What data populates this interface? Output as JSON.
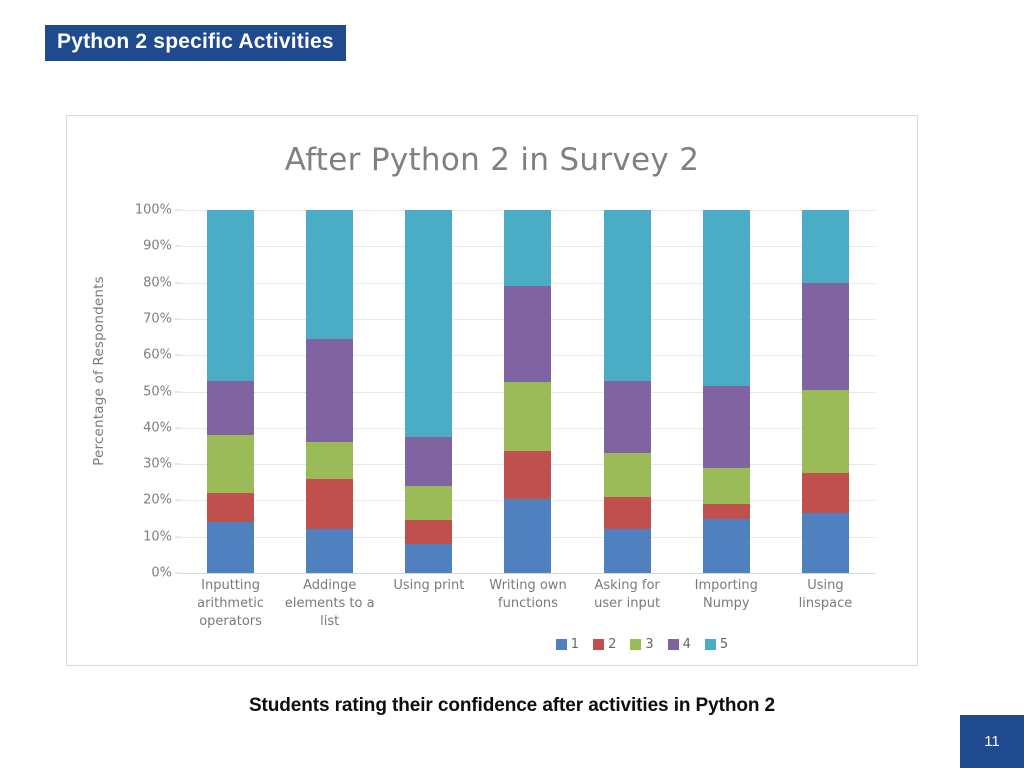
{
  "slide": {
    "title": "Python 2  specific Activities",
    "caption": "Students rating their confidence after activities in Python 2",
    "page_number": "11",
    "accent_color": "#1f4b8e"
  },
  "chart_data": {
    "type": "bar",
    "stacked": true,
    "title": "After Python 2 in Survey 2",
    "xlabel": "",
    "ylabel": "Percentage of Respondents",
    "ylim": [
      0,
      100
    ],
    "ytick_labels": [
      "100%",
      "90%",
      "80%",
      "70%",
      "60%",
      "50%",
      "40%",
      "30%",
      "20%",
      "10%",
      "0%"
    ],
    "ytick_values": [
      100,
      90,
      80,
      70,
      60,
      50,
      40,
      30,
      20,
      10,
      0
    ],
    "grid": true,
    "legend_position": "bottom-right",
    "categories": [
      "Inputting arithmetic operators",
      "Addinge elements to a list",
      "Using print",
      "Writing own functions",
      "Asking for user input",
      "Importing Numpy",
      "Using linspace"
    ],
    "category_lines": [
      [
        "Inputting",
        "arithmetic",
        "operators"
      ],
      [
        "Addinge",
        "elements to a",
        "list"
      ],
      [
        "Using print"
      ],
      [
        "Writing own",
        "functions"
      ],
      [
        "Asking for",
        "user input"
      ],
      [
        "Importing",
        "Numpy"
      ],
      [
        "Using",
        "linspace"
      ]
    ],
    "series": [
      {
        "name": "1",
        "color": "#4e81bd",
        "values": [
          14,
          12,
          8,
          20.5,
          12,
          15,
          16.5
        ]
      },
      {
        "name": "2",
        "color": "#c0504d",
        "values": [
          8,
          14,
          6.5,
          13,
          9,
          4,
          11
        ]
      },
      {
        "name": "3",
        "color": "#9bbb59",
        "values": [
          16,
          10,
          9.5,
          19,
          12,
          10,
          23
        ]
      },
      {
        "name": "4",
        "color": "#8064a2",
        "values": [
          15,
          28.5,
          13.5,
          26.5,
          20,
          22.5,
          29.5
        ]
      },
      {
        "name": "5",
        "color": "#4bacc6",
        "values": [
          47,
          35.5,
          62.5,
          21,
          47,
          48.5,
          20
        ]
      }
    ],
    "cumulative_tops": [
      [
        14,
        22,
        38,
        53,
        100
      ],
      [
        12,
        26,
        36,
        64.5,
        100
      ],
      [
        8,
        14.5,
        24,
        37.5,
        100
      ],
      [
        20.5,
        33.5,
        52.5,
        79,
        100
      ],
      [
        12,
        21,
        33,
        53,
        100
      ],
      [
        15,
        19,
        29,
        51.5,
        100
      ],
      [
        16.5,
        27.5,
        50.5,
        80,
        100
      ]
    ],
    "legend": [
      {
        "label": "1",
        "color": "#4e81bd"
      },
      {
        "label": "2",
        "color": "#c0504d"
      },
      {
        "label": "3",
        "color": "#9bbb59"
      },
      {
        "label": "4",
        "color": "#8064a2"
      },
      {
        "label": "5",
        "color": "#4bacc6"
      }
    ]
  }
}
